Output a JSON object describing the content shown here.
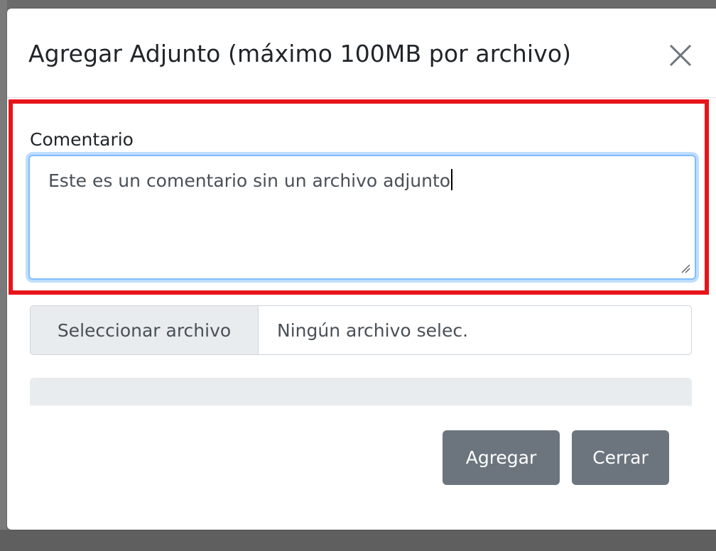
{
  "modal": {
    "title": "Agregar Adjunto (máximo 100MB por archivo)"
  },
  "comment": {
    "label": "Comentario",
    "value": "Este es un comentario sin un archivo adjunto"
  },
  "file": {
    "button_label": "Seleccionar archivo",
    "status": "Ningún archivo selec."
  },
  "progress": {
    "percent": 0
  },
  "footer": {
    "add_label": "Agregar",
    "close_label": "Cerrar"
  },
  "icons": {
    "close": "close-icon",
    "resize": "resize-grip-icon"
  },
  "colors": {
    "highlight": "#e8141b",
    "focus_border": "#80bdff",
    "secondary_button": "#6c757d",
    "input_addon": "#e9ecef"
  }
}
